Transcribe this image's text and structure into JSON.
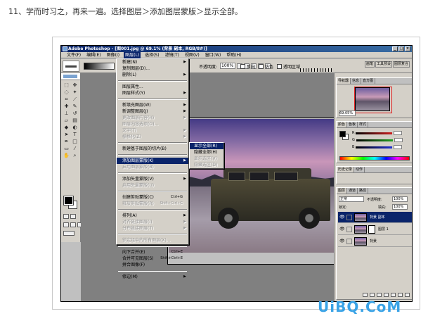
{
  "instruction": "11、学而时习之，再来一遍。选择图层＞添加图层蒙版＞显示全部。",
  "window": {
    "title": "Adobe Photoshop - [图001.jpg @ 69.1% (背景 副本, RGB/8#)]",
    "min": "_",
    "max": "□",
    "close": "×"
  },
  "menubar": {
    "items": [
      "文件(F)",
      "编辑(E)",
      "图像(I)",
      "图层(L)",
      "选择(S)",
      "滤镜(T)",
      "视图(V)",
      "窗口(W)",
      "帮助(H)"
    ],
    "active_index": 3
  },
  "options": {
    "opacity_label": "不透明度:",
    "opacity_value": "100%",
    "reverse": "反向",
    "dither": "仿色",
    "transparency": "透明区域"
  },
  "palette_well": [
    "画笔",
    "工具预设",
    "图层复合"
  ],
  "layer_menu": {
    "items": [
      {
        "label": "新建(N)",
        "arrow": "▶",
        "state": "enabled"
      },
      {
        "label": "复制图层(D)...",
        "state": "enabled"
      },
      {
        "label": "删除(L)",
        "arrow": "▶",
        "state": "enabled"
      },
      {
        "sep": true
      },
      {
        "label": "图层属性...",
        "state": "enabled"
      },
      {
        "label": "图层样式(Y)",
        "arrow": "▶",
        "state": "enabled"
      },
      {
        "sep": true
      },
      {
        "label": "新填充图层(W)",
        "arrow": "▶",
        "state": "enabled"
      },
      {
        "label": "新调整图层(J)",
        "arrow": "▶",
        "state": "enabled"
      },
      {
        "label": "更改图层内容(H)",
        "arrow": "▶",
        "state": "disabled"
      },
      {
        "label": "图层内容选项(O)...",
        "state": "disabled"
      },
      {
        "label": "文字(T)",
        "arrow": "▶",
        "state": "disabled"
      },
      {
        "label": "栅格化(Z)",
        "arrow": "▶",
        "state": "disabled"
      },
      {
        "sep": true
      },
      {
        "label": "新建基于图层的切片(B)",
        "state": "enabled"
      },
      {
        "sep": true
      },
      {
        "label": "添加图层蒙版(K)",
        "arrow": "▶",
        "state": "highlighted"
      },
      {
        "label": "启用图层蒙版(B)",
        "state": "disabled"
      },
      {
        "sep": true
      },
      {
        "label": "添加矢量蒙版(V)",
        "arrow": "▶",
        "state": "enabled"
      },
      {
        "label": "启用矢量蒙版(U)",
        "state": "disabled"
      },
      {
        "sep": true
      },
      {
        "label": "创建剪贴蒙版(C)",
        "shortcut": "Ctrl+G",
        "state": "enabled"
      },
      {
        "label": "释放剪贴蒙版(R)",
        "shortcut": "Shift+Ctrl+G",
        "state": "disabled"
      },
      {
        "sep": true
      },
      {
        "label": "排列(A)",
        "arrow": "▶",
        "state": "enabled"
      },
      {
        "label": "对齐链接图层(I)",
        "arrow": "▶",
        "state": "disabled"
      },
      {
        "label": "分布链接图层(T)",
        "arrow": "▶",
        "state": "disabled"
      },
      {
        "sep": true
      },
      {
        "label": "锁定组中的所有图层(X)...",
        "state": "disabled"
      },
      {
        "sep": true
      },
      {
        "label": "向下合并(E)",
        "shortcut": "Ctrl+E",
        "state": "enabled"
      },
      {
        "label": "合并可见图层(S)",
        "shortcut": "Shift+Ctrl+E",
        "state": "enabled"
      },
      {
        "label": "拼合图像(F)",
        "state": "enabled"
      },
      {
        "sep": true
      },
      {
        "label": "修边(M)",
        "arrow": "▶",
        "state": "enabled"
      }
    ]
  },
  "submenu": {
    "items": [
      {
        "label": "显示全部(R)",
        "state": "highlighted"
      },
      {
        "label": "隐藏全部(H)",
        "state": "enabled"
      },
      {
        "label": "显示选区(V)",
        "state": "disabled"
      },
      {
        "label": "隐藏选区(D)",
        "state": "disabled"
      }
    ]
  },
  "navigator": {
    "tabs": [
      "导航器",
      "信息",
      "直方图"
    ],
    "zoom": "69.05%"
  },
  "color_panel": {
    "tabs": [
      "颜色",
      "色板",
      "样式"
    ],
    "channels": [
      "R",
      "G",
      "B"
    ],
    "channel_colors": [
      "#cc2020",
      "#20a020",
      "#2030d0"
    ]
  },
  "history_panel": {
    "tabs": [
      "历史记录",
      "动作"
    ]
  },
  "layers_panel": {
    "tabs": [
      "图层",
      "通道",
      "路径"
    ],
    "blend_mode": "正常",
    "opacity_label": "不透明度:",
    "opacity_value": "100%",
    "lock_label": "锁定:",
    "fill_label": "填充:",
    "fill_value": "100%",
    "layers": [
      {
        "name": "背景 副本",
        "selected": true,
        "eye": "👁"
      },
      {
        "name": "图层 1",
        "selected": false,
        "eye": "👁"
      },
      {
        "name": "背景",
        "selected": false,
        "eye": "👁"
      }
    ]
  },
  "watermark": "UiBQ.CoM"
}
